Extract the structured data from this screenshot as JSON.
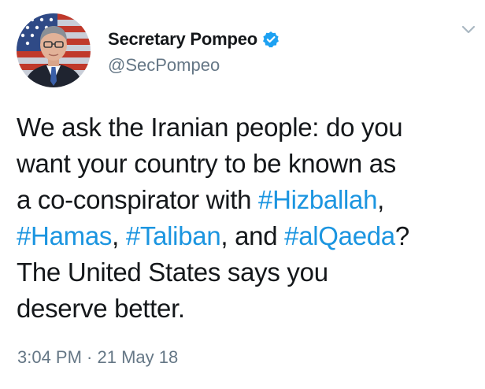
{
  "author": {
    "display_name": "Secretary Pompeo",
    "handle": "@SecPompeo",
    "verified": true
  },
  "tweet": {
    "lines": [
      [
        {
          "text": "We ask the Iranian people: do you",
          "hashtag": false
        }
      ],
      [
        {
          "text": "want your country to be known as",
          "hashtag": false
        }
      ],
      [
        {
          "text": "a co-conspirator with ",
          "hashtag": false
        },
        {
          "text": "#Hizballah",
          "hashtag": true
        },
        {
          "text": ",",
          "hashtag": false
        }
      ],
      [
        {
          "text": "#Hamas",
          "hashtag": true
        },
        {
          "text": ", ",
          "hashtag": false
        },
        {
          "text": "#Taliban",
          "hashtag": true
        },
        {
          "text": ", and ",
          "hashtag": false
        },
        {
          "text": "#alQaeda",
          "hashtag": true
        },
        {
          "text": "?",
          "hashtag": false
        }
      ],
      [
        {
          "text": "The United States says you",
          "hashtag": false
        }
      ],
      [
        {
          "text": "deserve better.",
          "hashtag": false
        }
      ]
    ],
    "timestamp": "3:04 PM · 21 May 18"
  },
  "colors": {
    "hashtag": "#1b95e0",
    "secondary_text": "#657786",
    "verified_badge": "#1da1f2",
    "primary_text": "#14171a"
  },
  "icons": {
    "verified": "verified-badge-icon",
    "menu": "chevron-down-icon"
  }
}
